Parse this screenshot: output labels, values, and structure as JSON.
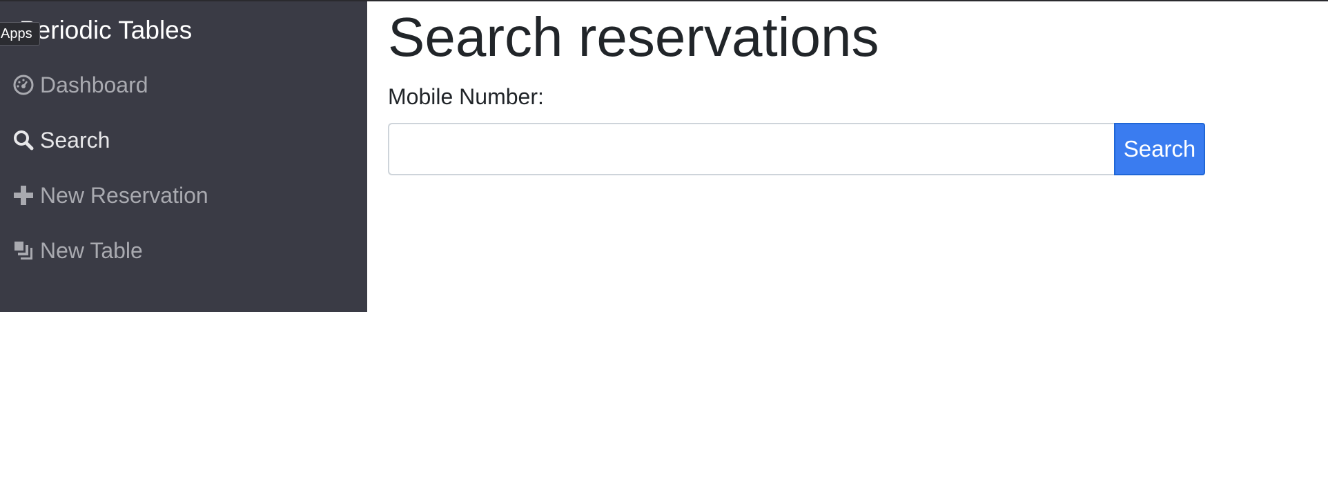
{
  "app": {
    "brand": "Periodic Tables",
    "tooltip": "Apps"
  },
  "sidebar": {
    "items": [
      {
        "label": "Dashboard",
        "icon": "dashboard-icon",
        "active": false
      },
      {
        "label": "Search",
        "icon": "search-icon",
        "active": true
      },
      {
        "label": "New Reservation",
        "icon": "plus-icon",
        "active": false
      },
      {
        "label": "New Table",
        "icon": "table-icon",
        "active": false
      }
    ]
  },
  "main": {
    "title": "Search reservations",
    "mobile_label": "Mobile Number:",
    "mobile_value": "",
    "mobile_placeholder": "",
    "search_button": "Search"
  },
  "colors": {
    "sidebar_bg": "#3a3b45",
    "accent": "#3a7cf0",
    "nav_text": "#a9aab0",
    "nav_active_text": "#e8e8ea"
  }
}
